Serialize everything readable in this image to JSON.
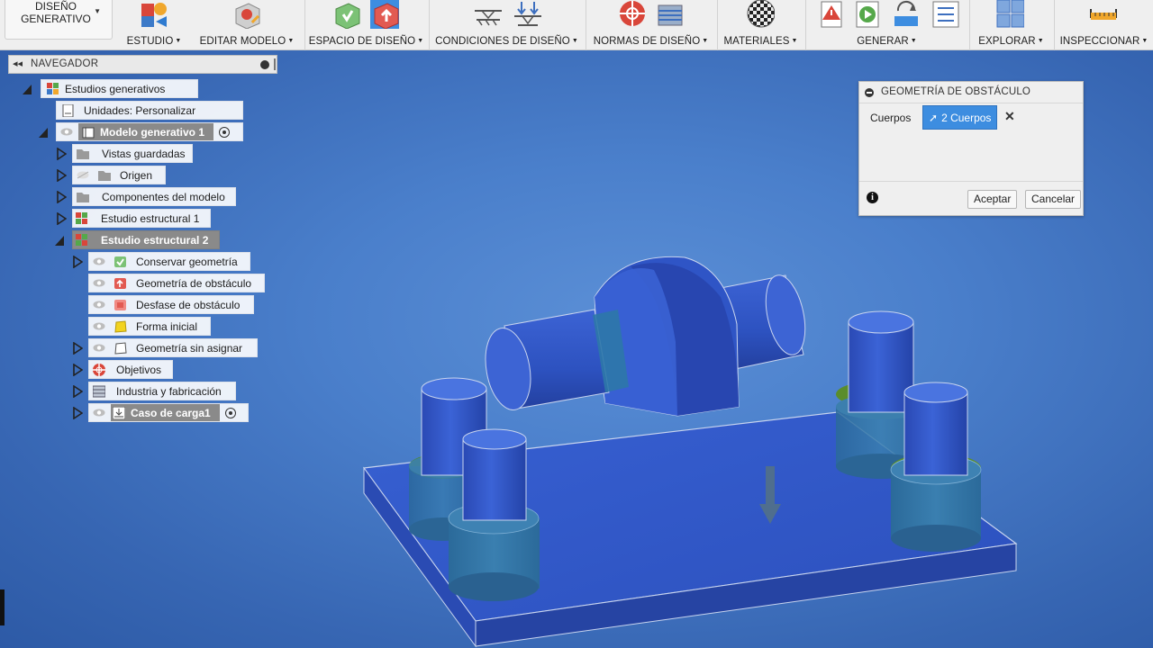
{
  "toolbar": {
    "workspace": "DISEÑO\nGENERATIVO",
    "groups": [
      {
        "label": "ESTUDIO"
      },
      {
        "label": "EDITAR MODELO"
      },
      {
        "label": "ESPACIO DE DISEÑO"
      },
      {
        "label": "CONDICIONES DE DISEÑO"
      },
      {
        "label": "NORMAS DE DISEÑO"
      },
      {
        "label": "MATERIALES"
      },
      {
        "label": "GENERAR"
      },
      {
        "label": "EXPLORAR"
      },
      {
        "label": "INSPECCIONAR"
      }
    ]
  },
  "navigator": {
    "title": "NAVEGADOR",
    "items": [
      {
        "label": "Estudios generativos"
      },
      {
        "label": "Unidades: Personalizar"
      },
      {
        "label": "Modelo generativo 1"
      },
      {
        "label": "Vistas guardadas"
      },
      {
        "label": "Origen"
      },
      {
        "label": "Componentes del modelo"
      },
      {
        "label": "Estudio estructural 1"
      },
      {
        "label": "Estudio estructural 2"
      },
      {
        "label": "Conservar geometría"
      },
      {
        "label": "Geometría de obstáculo"
      },
      {
        "label": "Desfase de obstáculo"
      },
      {
        "label": "Forma inicial"
      },
      {
        "label": "Geometría sin asignar"
      },
      {
        "label": "Objetivos"
      },
      {
        "label": "Industria y fabricación"
      },
      {
        "label": "Caso de carga1"
      }
    ]
  },
  "dialog": {
    "title": "GEOMETRÍA DE OBSTÁCULO",
    "field_label": "Cuerpos",
    "selection": "2 Cuerpos",
    "ok": "Aceptar",
    "cancel": "Cancelar"
  },
  "colors": {
    "viewport": "#4a7fcb",
    "selection": "#3d8de0",
    "model_blue": "#2f55c6",
    "preserve_green": "#5e8f2a"
  }
}
